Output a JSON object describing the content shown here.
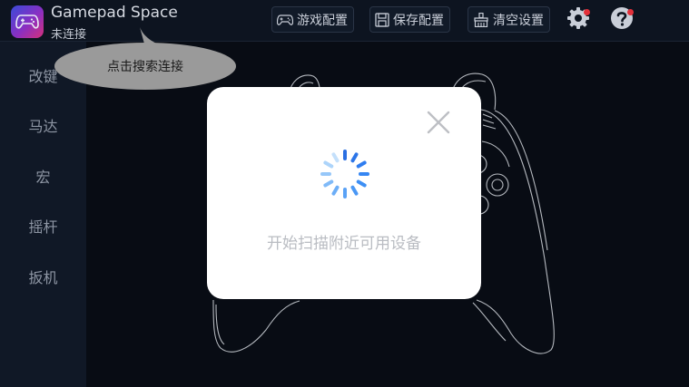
{
  "app": {
    "title": "Gamepad Space",
    "connection_status": "未连接"
  },
  "toolbar": {
    "game_config_label": "游戏配置",
    "save_config_label": "保存配置",
    "clear_settings_label": "清空设置"
  },
  "sidebar": {
    "items": [
      {
        "label": "改键"
      },
      {
        "label": "马达"
      },
      {
        "label": "宏"
      },
      {
        "label": "摇杆"
      },
      {
        "label": "扳机"
      }
    ]
  },
  "tooltip": {
    "text": "点击搜索连接"
  },
  "dialog": {
    "message": "开始扫描附近可用设备"
  },
  "colors": {
    "accent": "#2f7df0",
    "notification_dot": "#e3303a",
    "background": "#0a0f1a"
  }
}
